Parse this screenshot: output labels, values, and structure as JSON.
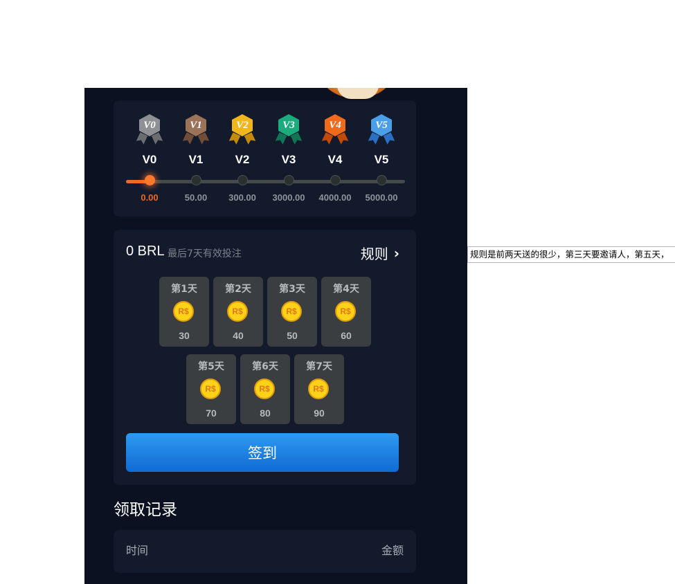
{
  "vip": {
    "levels": [
      {
        "badge": "V0",
        "label": "V0",
        "amount": "0.00",
        "color": "#8e9093",
        "ribbon": "#6a6c70",
        "active": true
      },
      {
        "badge": "V1",
        "label": "V1",
        "amount": "50.00",
        "color": "#9b7358",
        "ribbon": "#6f4d38",
        "active": false
      },
      {
        "badge": "V2",
        "label": "V2",
        "amount": "300.00",
        "color": "#f0b61c",
        "ribbon": "#c48a0a",
        "active": false
      },
      {
        "badge": "V3",
        "label": "V3",
        "amount": "3000.00",
        "color": "#1bab7c",
        "ribbon": "#117454",
        "active": false
      },
      {
        "badge": "V4",
        "label": "V4",
        "amount": "4000.00",
        "color": "#f06a1c",
        "ribbon": "#c04a0a",
        "active": false
      },
      {
        "badge": "V5",
        "label": "V5",
        "amount": "5000.00",
        "color": "#4a9fe8",
        "ribbon": "#2a6fc0",
        "active": false
      }
    ],
    "progress": 0.08
  },
  "signin": {
    "balance": "0 BRL",
    "balance_note": "最后7天有效投注",
    "rules_label": "规则",
    "days": [
      {
        "name": "第1天",
        "coin": "R$",
        "value": "30"
      },
      {
        "name": "第2天",
        "coin": "R$",
        "value": "40"
      },
      {
        "name": "第3天",
        "coin": "R$",
        "value": "50"
      },
      {
        "name": "第4天",
        "coin": "R$",
        "value": "60"
      },
      {
        "name": "第5天",
        "coin": "R$",
        "value": "70"
      },
      {
        "name": "第6天",
        "coin": "R$",
        "value": "80"
      },
      {
        "name": "第7天",
        "coin": "R$",
        "value": "90"
      }
    ],
    "button_label": "签到"
  },
  "records": {
    "title": "领取记录",
    "col_time": "时间",
    "col_amount": "金额"
  },
  "tooltip": "规则是前两天送的很少，第三天要邀请人，第五天，",
  "colors": {
    "accent_orange": "#ef6a23",
    "button_blue": "#1a82e2",
    "panel_bg": "#121a2c",
    "page_bg": "#0b1120"
  }
}
